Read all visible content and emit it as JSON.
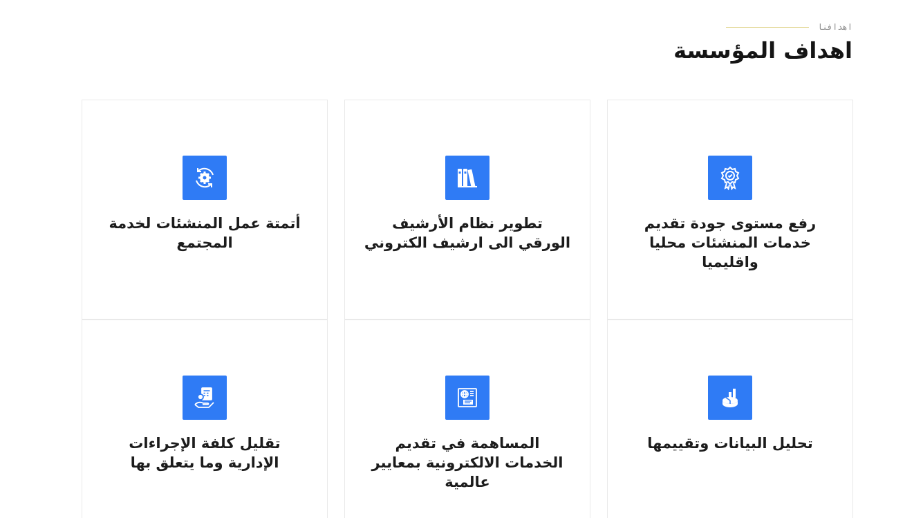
{
  "section": {
    "eyebrow": "اهدافنا",
    "title": "اهداف المؤسسة"
  },
  "cards": [
    {
      "icon": "award-badge-icon",
      "text": "رفع مستوى جودة تقديم خدمات المنشئات محليا واقليميا"
    },
    {
      "icon": "archive-binders-icon",
      "text": "تطوير نظام الأرشيف الورقي الى ارشيف الكتروني"
    },
    {
      "icon": "gear-cycle-icon",
      "text": "أتمتة عمل المنشئات لخدمة المجتمع"
    },
    {
      "icon": "data-chart-icon",
      "text": "تحليل البيانات وتقييمها"
    },
    {
      "icon": "online-services-icon",
      "text": "المساهمة في تقديم الخدمات الالكترونية بمعايير عالمية"
    },
    {
      "icon": "cost-reduction-icon",
      "text": "تقليل كلفة الإجراءات الإدارية وما يتعلق بها"
    }
  ],
  "colors": {
    "accent": "#2f7bf5",
    "eyebrow_line": "#e0d48a",
    "card_border": "#e9e9e9"
  }
}
